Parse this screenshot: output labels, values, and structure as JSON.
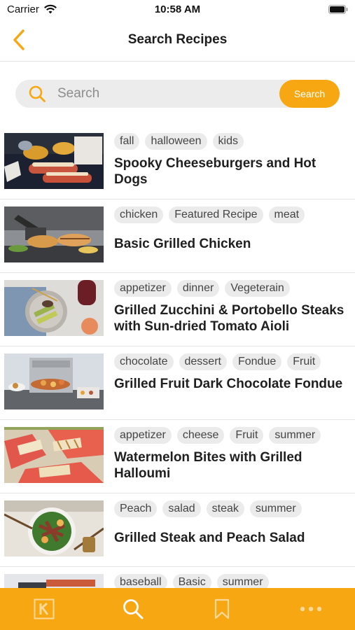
{
  "status": {
    "carrier": "Carrier",
    "time": "10:58 AM"
  },
  "nav": {
    "title": "Search Recipes"
  },
  "search": {
    "placeholder": "Search",
    "button_label": "Search"
  },
  "recipes": [
    {
      "tags": [
        "fall",
        "halloween",
        "kids"
      ],
      "title": "Spooky Cheeseburgers and Hot Dogs"
    },
    {
      "tags": [
        "chicken",
        "Featured Recipe",
        "meat"
      ],
      "title": "Basic Grilled Chicken"
    },
    {
      "tags": [
        "appetizer",
        "dinner",
        "Vegeterain"
      ],
      "title": "Grilled Zucchini & Portobello Steaks with Sun-dried Tomato Aioli"
    },
    {
      "tags": [
        "chocolate",
        "dessert",
        "Fondue",
        "Fruit"
      ],
      "title": "Grilled Fruit Dark Chocolate Fondue"
    },
    {
      "tags": [
        "appetizer",
        "cheese",
        "Fruit",
        "summer"
      ],
      "title": "Watermelon Bites with Grilled Halloumi"
    },
    {
      "tags": [
        "Peach",
        "salad",
        "steak",
        "summer"
      ],
      "title": "Grilled Steak and Peach Salad"
    },
    {
      "tags": [
        "baseball",
        "Basic",
        "summer"
      ],
      "title": ""
    }
  ],
  "tabbar": {
    "items": [
      {
        "icon": "k-logo-icon"
      },
      {
        "icon": "search-icon"
      },
      {
        "icon": "bookmark-icon"
      },
      {
        "icon": "more-icon"
      }
    ]
  },
  "colors": {
    "accent": "#f7a711",
    "tag_bg": "#ebebeb",
    "search_bg": "#ececec"
  }
}
